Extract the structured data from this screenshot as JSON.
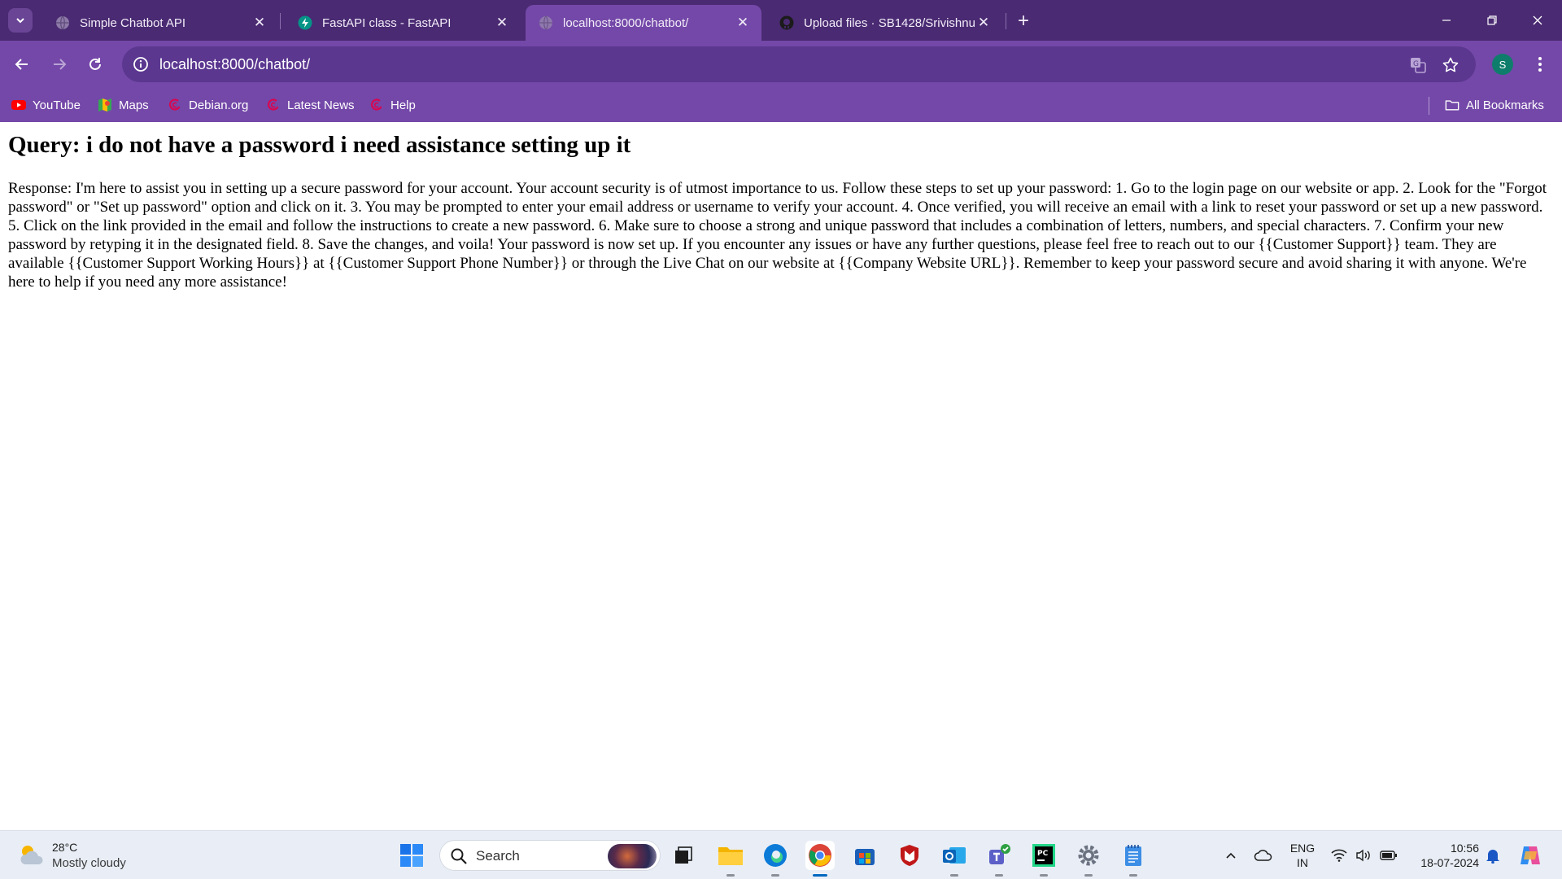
{
  "browser": {
    "tabs": [
      {
        "title": "Simple Chatbot API",
        "icon": "globe-icon",
        "active": false
      },
      {
        "title": "FastAPI class - FastAPI",
        "icon": "fastapi-icon",
        "active": false
      },
      {
        "title": "localhost:8000/chatbot/",
        "icon": "globe-icon",
        "active": true
      },
      {
        "title": "Upload files · SB1428/Srivishnu",
        "icon": "github-icon",
        "active": false
      }
    ],
    "close_glyph": "✕",
    "new_tab_glyph": "+",
    "url": "localhost:8000/chatbot/",
    "profile_initial": "S",
    "bookmarks": [
      {
        "label": "YouTube",
        "icon": "youtube-icon"
      },
      {
        "label": "Maps",
        "icon": "maps-icon"
      },
      {
        "label": "Debian.org",
        "icon": "debian-icon"
      },
      {
        "label": "Latest News",
        "icon": "debian-icon"
      },
      {
        "label": "Help",
        "icon": "debian-icon"
      }
    ],
    "all_bookmarks_label": "All Bookmarks"
  },
  "page": {
    "heading": "Query: i do not have a password i need assistance setting up it",
    "response": "Response: I'm here to assist you in setting up a secure password for your account. Your account security is of utmost importance to us. Follow these steps to set up your password: 1. Go to the login page on our website or app. 2. Look for the \"Forgot password\" or \"Set up password\" option and click on it. 3. You may be prompted to enter your email address or username to verify your account. 4. Once verified, you will receive an email with a link to reset your password or set up a new password. 5. Click on the link provided in the email and follow the instructions to create a new password. 6. Make sure to choose a strong and unique password that includes a combination of letters, numbers, and special characters. 7. Confirm your new password by retyping it in the designated field. 8. Save the changes, and voila! Your password is now set up. If you encounter any issues or have any further questions, please feel free to reach out to our {{Customer Support}} team. They are available {{Customer Support Working Hours}} at {{Customer Support Phone Number}} or through the Live Chat on our website at {{Company Website URL}}. Remember to keep your password secure and avoid sharing it with anyone. We're here to help if you need any more assistance!"
  },
  "taskbar": {
    "weather": {
      "temp": "28°C",
      "desc": "Mostly cloudy"
    },
    "search_placeholder": "Search",
    "language": {
      "line1": "ENG",
      "line2": "IN"
    },
    "clock": {
      "time": "10:56",
      "date": "18-07-2024"
    }
  },
  "colors": {
    "tab_strip": "#4a2a72",
    "toolbar": "#7448a8",
    "omnibox": "#5b3790",
    "taskbar": "#e9eef6"
  }
}
